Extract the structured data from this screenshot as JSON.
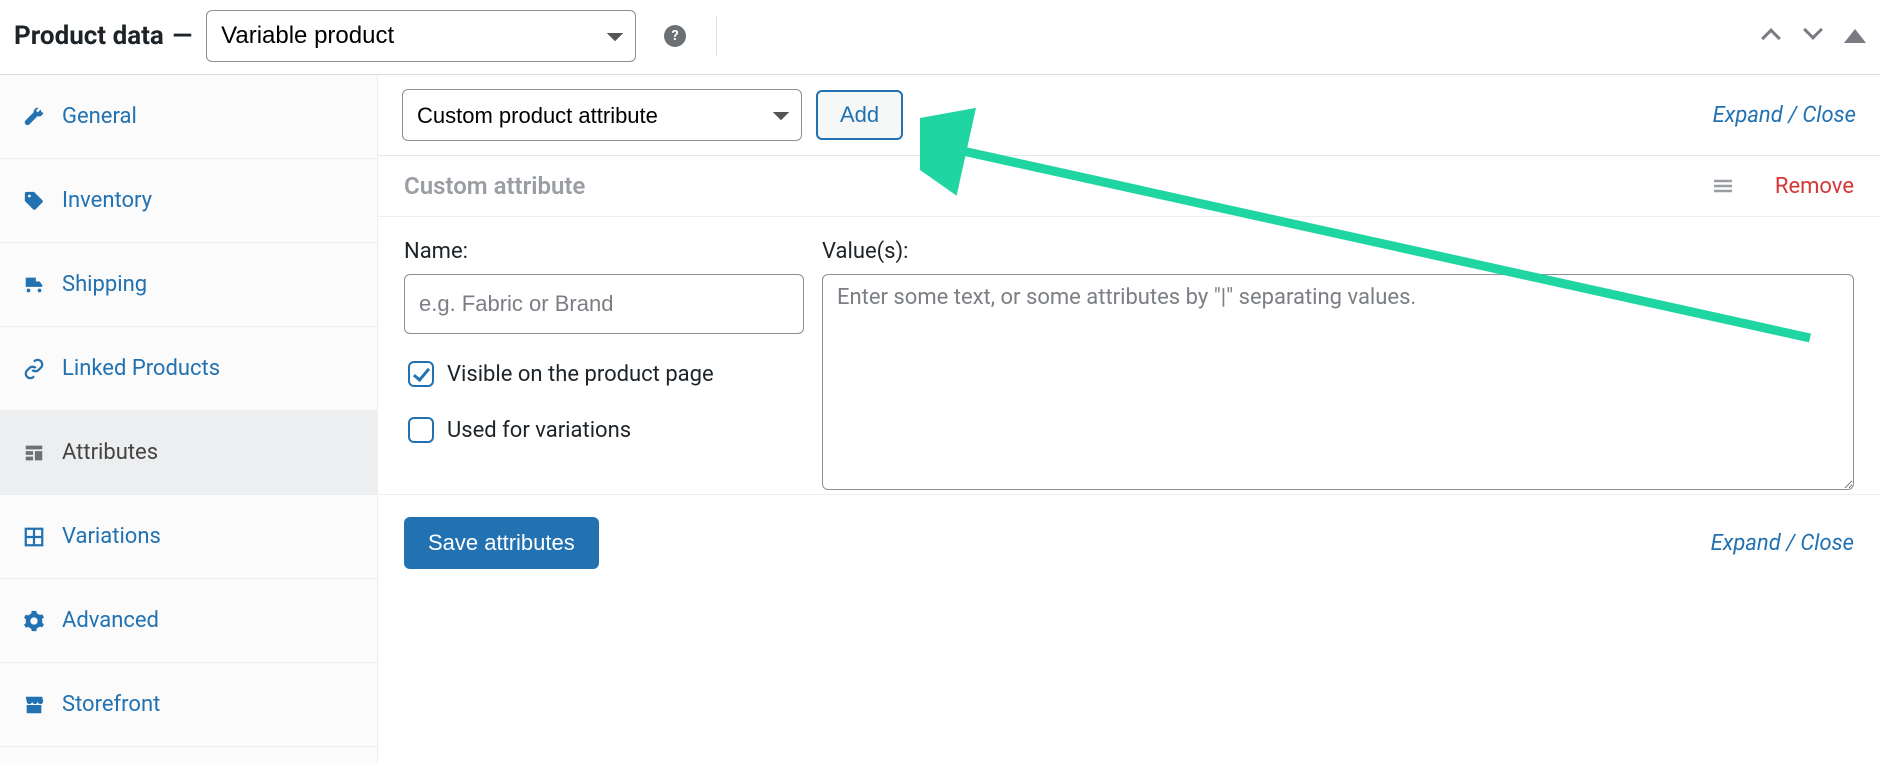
{
  "header": {
    "panel_title": "Product data",
    "dash": "—",
    "product_type": "Variable product"
  },
  "sidebar": {
    "items": [
      {
        "id": "general",
        "label": "General",
        "icon": "wrench-icon"
      },
      {
        "id": "inventory",
        "label": "Inventory",
        "icon": "tag-icon"
      },
      {
        "id": "shipping",
        "label": "Shipping",
        "icon": "truck-icon"
      },
      {
        "id": "linked-products",
        "label": "Linked Products",
        "icon": "link-icon"
      },
      {
        "id": "attributes",
        "label": "Attributes",
        "icon": "list-icon",
        "active": true
      },
      {
        "id": "variations",
        "label": "Variations",
        "icon": "grid-icon"
      },
      {
        "id": "advanced",
        "label": "Advanced",
        "icon": "gear-icon"
      },
      {
        "id": "storefront",
        "label": "Storefront",
        "icon": "store-icon"
      }
    ]
  },
  "toolbar": {
    "attribute_type_selected": "Custom product attribute",
    "add_label": "Add",
    "expand_label": "Expand",
    "close_label": "Close"
  },
  "attribute": {
    "header_title": "Custom attribute",
    "remove_label": "Remove",
    "name_label": "Name:",
    "name_value": "",
    "name_placeholder": "e.g. Fabric or Brand",
    "values_label": "Value(s):",
    "values_value": "",
    "values_placeholder": "Enter some text, or some attributes by \"|\" separating values.",
    "visible_label": "Visible on the product page",
    "visible_checked": true,
    "used_for_variations_label": "Used for variations",
    "used_for_variations_checked": false
  },
  "footer": {
    "save_label": "Save attributes",
    "expand_label": "Expand",
    "close_label": "Close"
  },
  "annotation": {
    "color": "#1fd6a2"
  }
}
